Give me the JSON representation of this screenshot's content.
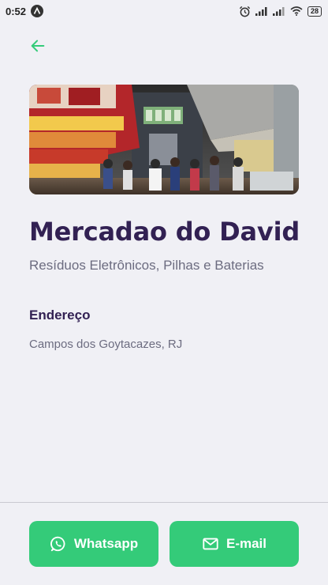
{
  "status_bar": {
    "time": "0:52",
    "battery": "28",
    "icons": [
      "alarm-icon",
      "signal-icon",
      "signal-icon",
      "wifi-icon",
      "battery-icon"
    ]
  },
  "header": {
    "back_icon": "arrow-left-icon"
  },
  "point": {
    "name": "Mercadao do David",
    "items": "Resíduos Eletrônicos, Pilhas e Baterias",
    "address_label": "Endereço",
    "address": "Campos dos Goytacazes, RJ"
  },
  "footer": {
    "whatsapp_label": "Whatsapp",
    "email_label": "E-mail"
  },
  "colors": {
    "background": "#F0F0F5",
    "primary": "#34CB79",
    "title": "#322153",
    "text": "#6C6C80"
  }
}
